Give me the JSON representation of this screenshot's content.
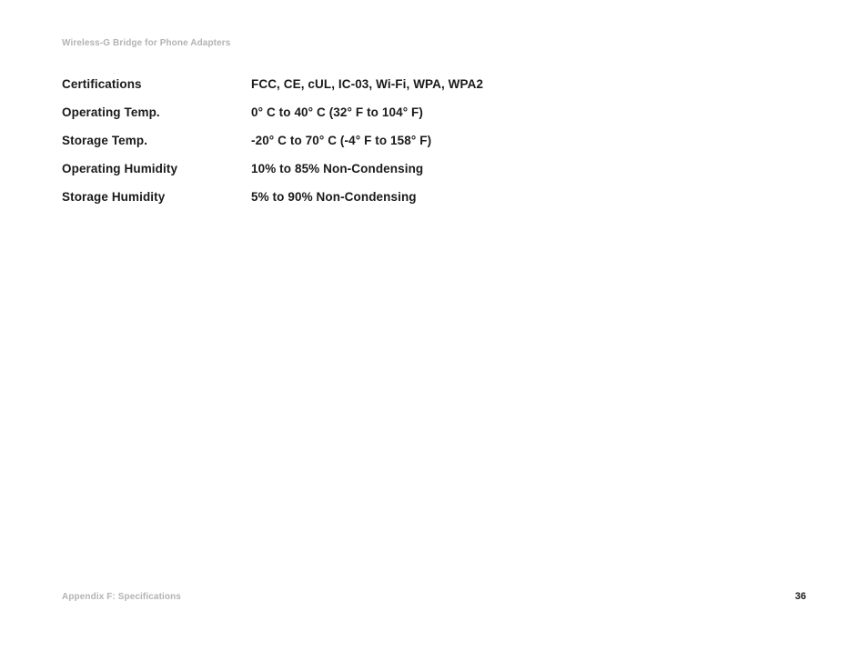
{
  "header": "Wireless-G Bridge for Phone Adapters",
  "specs": [
    {
      "label": "Certifications",
      "value": "FCC, CE, cUL, IC-03, Wi-Fi, WPA, WPA2"
    },
    {
      "label": "Operating Temp.",
      "value": "0° C to 40° C (32° F to 104° F)"
    },
    {
      "label": "Storage Temp.",
      "value": "-20° C to 70° C (-4° F to 158° F)"
    },
    {
      "label": "Operating Humidity",
      "value": "10% to 85% Non-Condensing"
    },
    {
      "label": "Storage Humidity",
      "value": "5% to 90% Non-Condensing"
    }
  ],
  "footer": {
    "label": "Appendix F: Specifications",
    "page": "36"
  }
}
